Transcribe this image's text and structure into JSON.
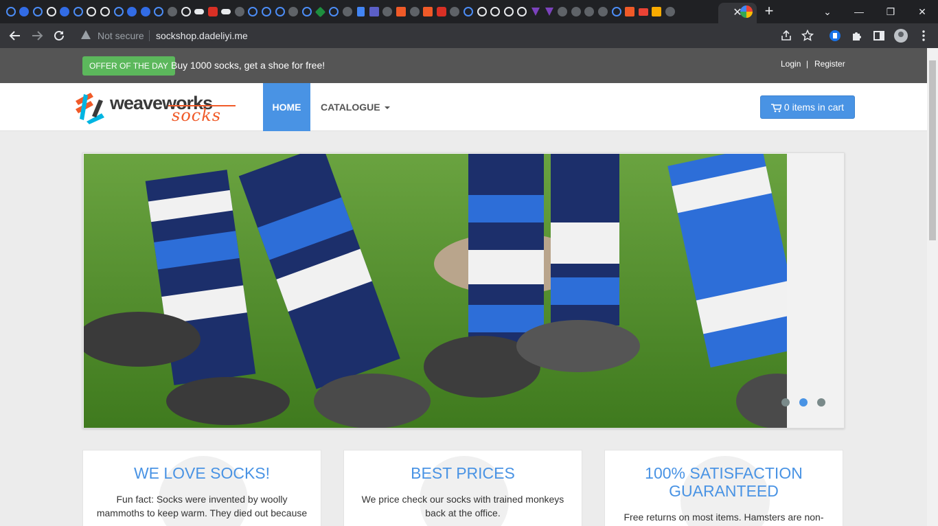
{
  "browser": {
    "active_tab_close": "✕",
    "new_tab": "+",
    "window_controls": {
      "dropdown": "⌄",
      "minimize": "—",
      "restore": "❐",
      "close": "✕"
    },
    "security_label": "Not secure",
    "url": "sockshop.dadeliyi.me",
    "accent_color": "#4c8df6"
  },
  "topbar": {
    "offer_badge": "OFFER OF THE DAY",
    "offer_text": "Buy 1000 socks, get a shoe for free!",
    "login": "Login",
    "separator": "|",
    "register": "Register"
  },
  "navbar": {
    "logo_word1": "weaveworks",
    "logo_word2": "socks",
    "home": "HOME",
    "catalogue": "CATALOGUE",
    "cart": "0 items in cart",
    "brand_color": "#4993e4"
  },
  "slider": {
    "image_subject": "rugby players' legs in blue and white striped socks on grass",
    "dots": 3,
    "active_dot": 2
  },
  "features": [
    {
      "title": "WE LOVE SOCKS!",
      "text": "Fun fact: Socks were invented by woolly mammoths to keep warm. They died out because"
    },
    {
      "title": "BEST PRICES",
      "text": "We price check our socks with trained monkeys back at the office."
    },
    {
      "title": "100% SATISFACTION GUARANTEED",
      "text": "Free returns on most items. Hamsters are non-"
    }
  ]
}
